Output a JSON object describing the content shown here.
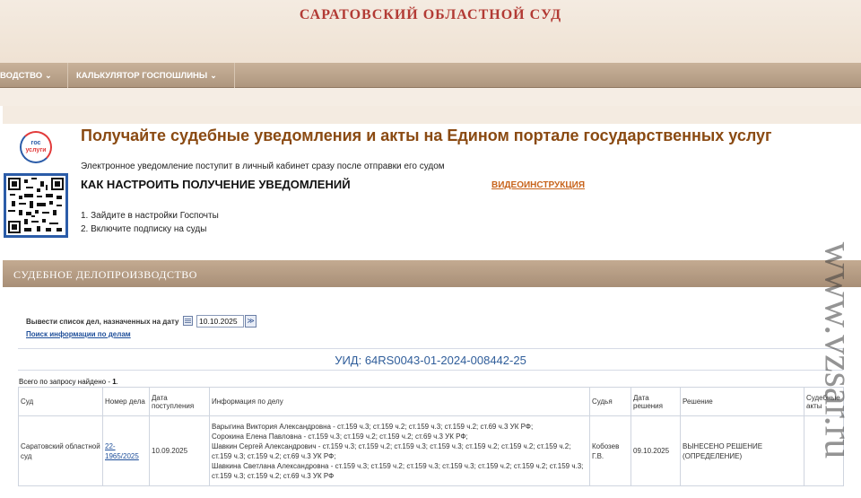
{
  "header": {
    "site_title": "САРАТОВСКИЙ ОБЛАСТНОЙ СУД"
  },
  "nav": [
    {
      "label": "ВОДСТВО"
    },
    {
      "label": "КАЛЬКУЛЯТОР ГОСПОШЛИНЫ"
    }
  ],
  "promo": {
    "logo_line1": "гос",
    "logo_line2": "услуги",
    "heading": "Получайте судебные уведомления и акты на Едином портале государственных услуг",
    "description": "Электронное уведомление поступит в личный кабинет сразу после отправки его судом",
    "howto_title": "КАК НАСТРОИТЬ ПОЛУЧЕНИЕ УВЕДОМЛЕНИЙ",
    "video_link": "ВИДЕОИНСТРУКЦИЯ",
    "steps": [
      "1. Зайдите в настройки Госпочты",
      "2. Включите подписку на суды"
    ]
  },
  "section": {
    "title": "СУДЕБНОЕ ДЕЛОПРОИЗВОДСТВО"
  },
  "search": {
    "date_label": "Вывести список дел, назначенных на дату",
    "date_value": "10.10.2025",
    "go_symbol": "≫",
    "search_link": "Поиск информации по делам"
  },
  "result": {
    "uid": "УИД: 64RS0043-01-2024-008442-25",
    "found_prefix": "Всего по запросу найдено - ",
    "found_count": "1",
    "found_suffix": "."
  },
  "table": {
    "headers": [
      "Суд",
      "Номер дела",
      "Дата поступления",
      "Информация по делу",
      "Судья",
      "Дата решения",
      "Решение",
      "Судебные акты"
    ],
    "row": {
      "court": "Саратовский областной суд",
      "case_number": "22-1965/2025",
      "received": "10.09.2025",
      "info": [
        "Варыгина Виктория Александровна - ст.159 ч.3; ст.159 ч.2; ст.159 ч.3; ст.159 ч.2; ст.69 ч.3 УК РФ;",
        "Сорокина Елена Павловна - ст.159 ч.3; ст.159 ч.2; ст.159 ч.2; ст.69 ч.3 УК РФ;",
        "Шавкин Сергей Александрович - ст.159 ч.3; ст.159 ч.2; ст.159 ч.3; ст.159 ч.3; ст.159 ч.2; ст.159 ч.2; ст.159 ч.2; ст.159 ч.3; ст.159 ч.2; ст.69 ч.3 УК РФ;",
        "Шавкина Светлана Александровна - ст.159 ч.3; ст.159 ч.2; ст.159 ч.3; ст.159 ч.3; ст.159 ч.2; ст.159 ч.2; ст.159 ч.3; ст.159 ч.3; ст.159 ч.2; ст.69 ч.3 УК РФ"
      ],
      "judge": "Кобозев Г.В.",
      "decision_date": "09.10.2025",
      "decision": "ВЫНЕСЕНО РЕШЕНИЕ (ОПРЕДЕЛЕНИЕ)",
      "acts": ""
    }
  },
  "watermark": "www.vzsar.ru",
  "colors": {
    "title_red": "#b23a34",
    "heading_brown": "#8a4a12",
    "link_blue": "#1f4f9a",
    "nav_bg": "#ae967e"
  }
}
